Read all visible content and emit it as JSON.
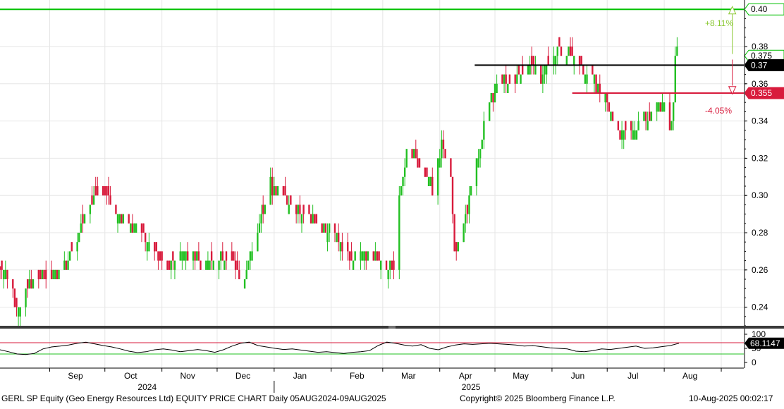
{
  "footer": {
    "left": "GERL SP Equity (Geo Energy Resources Ltd) EQUITY PRICE CHART  Daily 05AUG2024-09AUG2025",
    "center": "Copyright© 2025 Bloomberg Finance L.P.",
    "right": "10-Aug-2025 00:02:17"
  },
  "colors": {
    "up": "#22c022",
    "down": "#d81b3c",
    "grid": "#e6e6e6",
    "target_line": "#00c000",
    "resistance_line": "#000000",
    "support_line": "#d81b3c",
    "rsi_line": "#000000",
    "rsi_upper": "#d81b3c",
    "rsi_lower": "#22c022"
  },
  "chart_data": [
    {
      "type": "candlestick",
      "title": "",
      "x_range": [
        "2024-08-05",
        "2025-08-09"
      ],
      "ylim": [
        0.23,
        0.405
      ],
      "y_ticks": [
        "0.24",
        "0.26",
        "0.28",
        "0.30",
        "0.32",
        "0.34",
        "0.36",
        "0.38"
      ],
      "x_month_labels": [
        "Sep",
        "Oct",
        "Nov",
        "Dec",
        "Jan",
        "Feb",
        "Mar",
        "Apr",
        "May",
        "Jun",
        "Jul",
        "Aug"
      ],
      "x_year_labels": [
        "2024",
        "2025"
      ],
      "grid": true,
      "close_path": [
        [
          "2024-08-05",
          0.262
        ],
        [
          "2024-08-09",
          0.258
        ],
        [
          "2024-08-14",
          0.24
        ],
        [
          "2024-08-20",
          0.25
        ],
        [
          "2024-08-26",
          0.258
        ],
        [
          "2024-09-02",
          0.256
        ],
        [
          "2024-09-09",
          0.262
        ],
        [
          "2024-09-16",
          0.278
        ],
        [
          "2024-09-23",
          0.298
        ],
        [
          "2024-09-30",
          0.302
        ],
        [
          "2024-10-07",
          0.288
        ],
        [
          "2024-10-14",
          0.284
        ],
        [
          "2024-10-21",
          0.28
        ],
        [
          "2024-10-28",
          0.27
        ],
        [
          "2024-11-04",
          0.262
        ],
        [
          "2024-11-11",
          0.27
        ],
        [
          "2024-11-18",
          0.268
        ],
        [
          "2024-11-25",
          0.262
        ],
        [
          "2024-12-02",
          0.266
        ],
        [
          "2024-12-09",
          0.264
        ],
        [
          "2024-12-16",
          0.256
        ],
        [
          "2024-12-23",
          0.282
        ],
        [
          "2024-12-30",
          0.306
        ],
        [
          "2025-01-06",
          0.298
        ],
        [
          "2025-01-13",
          0.294
        ],
        [
          "2025-01-20",
          0.286
        ],
        [
          "2025-01-27",
          0.284
        ],
        [
          "2025-02-03",
          0.28
        ],
        [
          "2025-02-10",
          0.266
        ],
        [
          "2025-02-17",
          0.27
        ],
        [
          "2025-02-24",
          0.268
        ],
        [
          "2025-03-03",
          0.26
        ],
        [
          "2025-03-07",
          0.262
        ],
        [
          "2025-03-10",
          0.3
        ],
        [
          "2025-03-14",
          0.325
        ],
        [
          "2025-03-21",
          0.316
        ],
        [
          "2025-03-28",
          0.305
        ],
        [
          "2025-04-02",
          0.325
        ],
        [
          "2025-04-07",
          0.312
        ],
        [
          "2025-04-09",
          0.272
        ],
        [
          "2025-04-14",
          0.285
        ],
        [
          "2025-04-21",
          0.318
        ],
        [
          "2025-04-28",
          0.35
        ],
        [
          "2025-05-05",
          0.362
        ],
        [
          "2025-05-12",
          0.36
        ],
        [
          "2025-05-19",
          0.37
        ],
        [
          "2025-05-26",
          0.362
        ],
        [
          "2025-06-02",
          0.378
        ],
        [
          "2025-06-09",
          0.38
        ],
        [
          "2025-06-16",
          0.372
        ],
        [
          "2025-06-23",
          0.362
        ],
        [
          "2025-06-30",
          0.354
        ],
        [
          "2025-07-04",
          0.338
        ],
        [
          "2025-07-11",
          0.332
        ],
        [
          "2025-07-18",
          0.338
        ],
        [
          "2025-07-25",
          0.345
        ],
        [
          "2025-08-01",
          0.35
        ],
        [
          "2025-08-04",
          0.335
        ],
        [
          "2025-08-06",
          0.35
        ],
        [
          "2025-08-07",
          0.375
        ],
        [
          "2025-08-08",
          0.38
        ],
        [
          "2025-08-09",
          0.375
        ]
      ],
      "horizontal_levels": [
        {
          "label": "0.40",
          "value": 0.4,
          "color": "#00c000"
        },
        {
          "label": "0.375",
          "value": 0.375,
          "color": "#00c000"
        },
        {
          "label": "0.37",
          "value": 0.37,
          "color": "#000000"
        },
        {
          "label": "0.355",
          "value": 0.355,
          "color": "#d81b3c"
        }
      ],
      "annotations": [
        {
          "text": "+8.11%",
          "color": "#8ac832"
        },
        {
          "text": "-4.05%",
          "color": "#d81b3c"
        }
      ]
    },
    {
      "type": "line",
      "title": "",
      "ylim": [
        0,
        100
      ],
      "y_ticks": [
        "100",
        "50",
        "0"
      ],
      "reference_lines": [
        70,
        30
      ],
      "last_value_label": "68.1147",
      "values": [
        45,
        38,
        30,
        28,
        32,
        48,
        55,
        58,
        62,
        68,
        72,
        66,
        60,
        55,
        48,
        40,
        35,
        38,
        45,
        48,
        44,
        38,
        42,
        46,
        42,
        36,
        45,
        58,
        68,
        72,
        60,
        55,
        50,
        46,
        48,
        44,
        40,
        36,
        38,
        35,
        32,
        36,
        38,
        42,
        60,
        72,
        68,
        62,
        58,
        63,
        50,
        45,
        55,
        62,
        66,
        64,
        66,
        68,
        66,
        64,
        62,
        58,
        60,
        56,
        52,
        50,
        48,
        40,
        38,
        42,
        48,
        46,
        50,
        54,
        58,
        50,
        52,
        56,
        60,
        68
      ]
    }
  ]
}
